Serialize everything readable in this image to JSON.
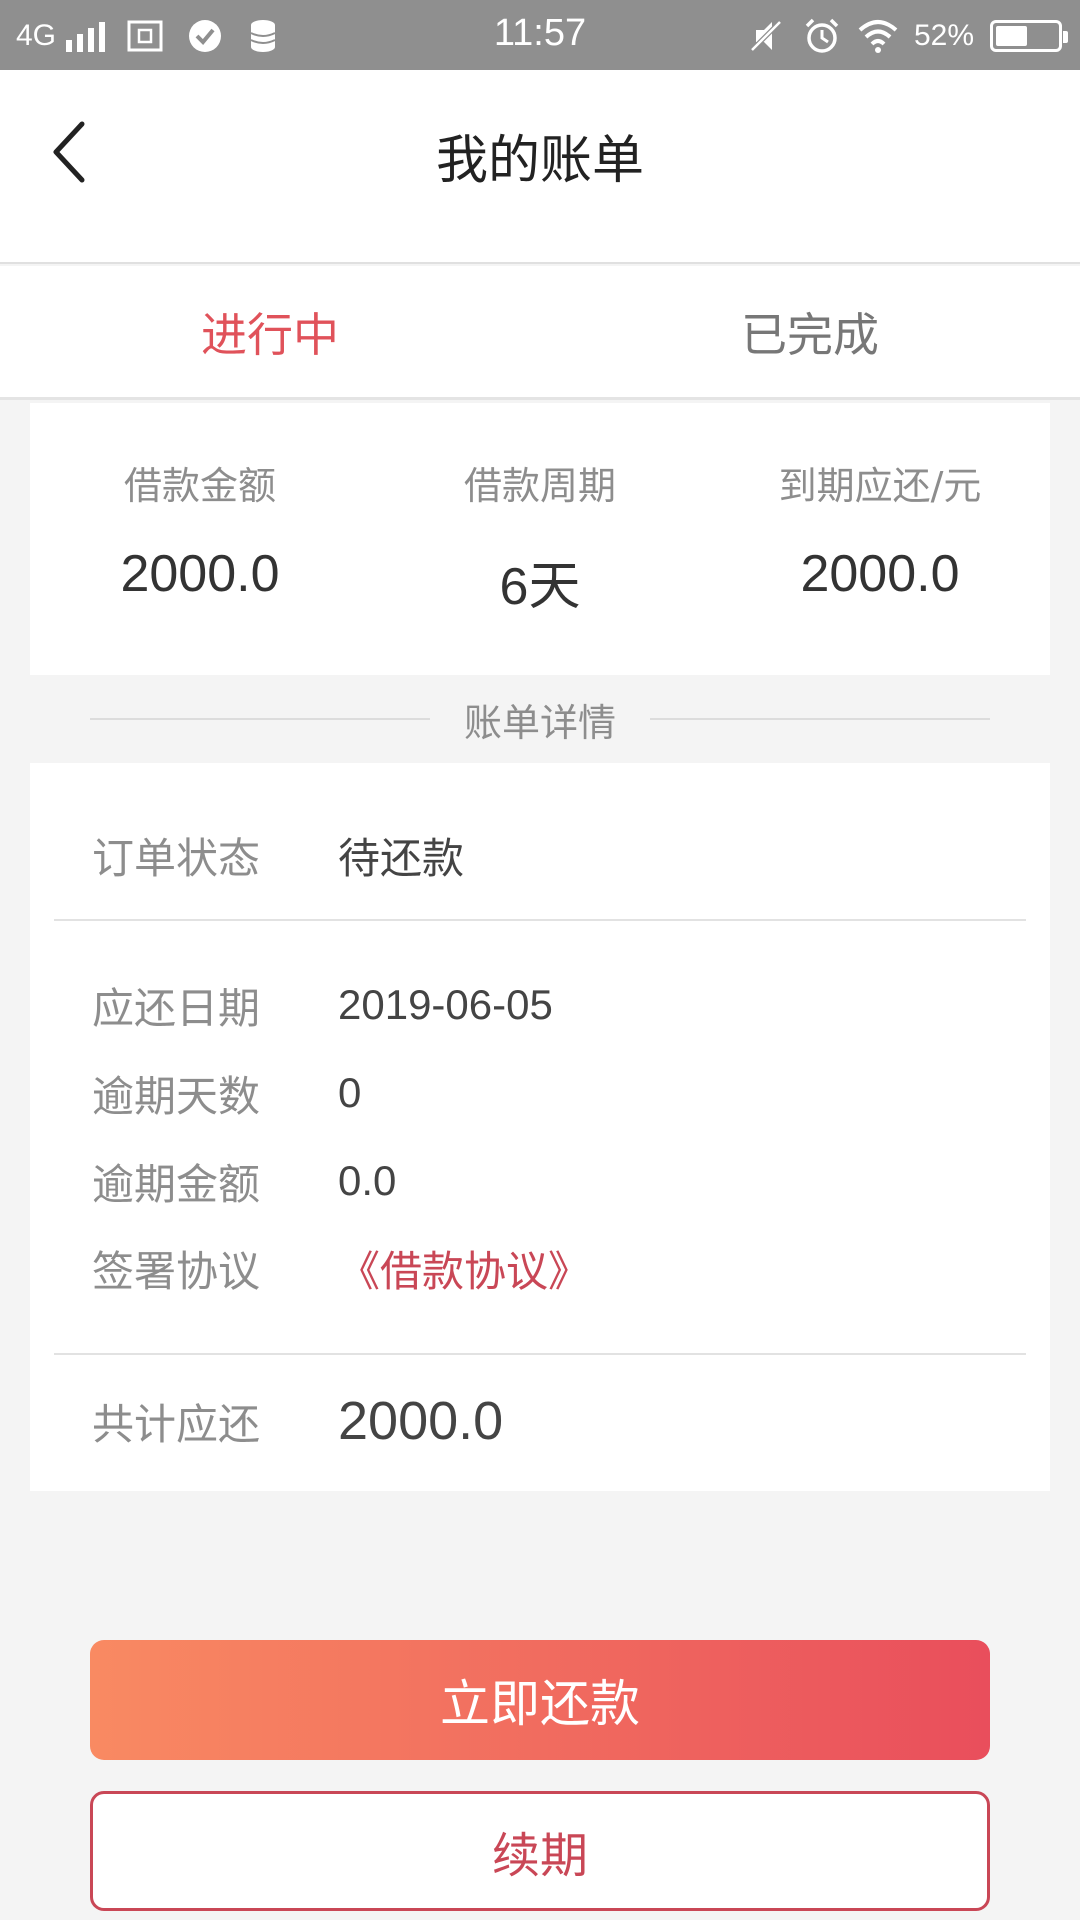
{
  "status_bar": {
    "network": "4G",
    "time": "11:57",
    "battery_text": "52%",
    "battery_level": 0.52,
    "icons": [
      "signal-icon",
      "screenshot-icon",
      "check-circle-icon",
      "database-icon",
      "mute-icon",
      "alarm-icon",
      "wifi-icon",
      "battery-icon"
    ]
  },
  "header": {
    "title": "我的账单",
    "back_icon": "chevron-left-icon"
  },
  "tabs": [
    {
      "label": "进行中",
      "active": true
    },
    {
      "label": "已完成",
      "active": false
    }
  ],
  "summary": [
    {
      "label": "借款金额",
      "value": "2000.0"
    },
    {
      "label": "借款周期",
      "value": "6天"
    },
    {
      "label": "到期应还/元",
      "value": "2000.0"
    }
  ],
  "details_title": "账单详情",
  "details": {
    "status": {
      "label": "订单状态",
      "value": "待还款"
    },
    "due_date": {
      "label": "应还日期",
      "value": "2019-06-05"
    },
    "overdue_days": {
      "label": "逾期天数",
      "value": "0"
    },
    "overdue_amount": {
      "label": "逾期金额",
      "value": "0.0"
    },
    "agreement": {
      "label": "签署协议",
      "value": "《借款协议》"
    },
    "total": {
      "label": "共计应还",
      "value": "2000.0"
    }
  },
  "buttons": {
    "repay": "立即还款",
    "renew": "续期"
  },
  "colors": {
    "accent": "#e0525a",
    "link": "#c94756",
    "gradient_start": "#f98a62",
    "gradient_end": "#e94e5c"
  }
}
